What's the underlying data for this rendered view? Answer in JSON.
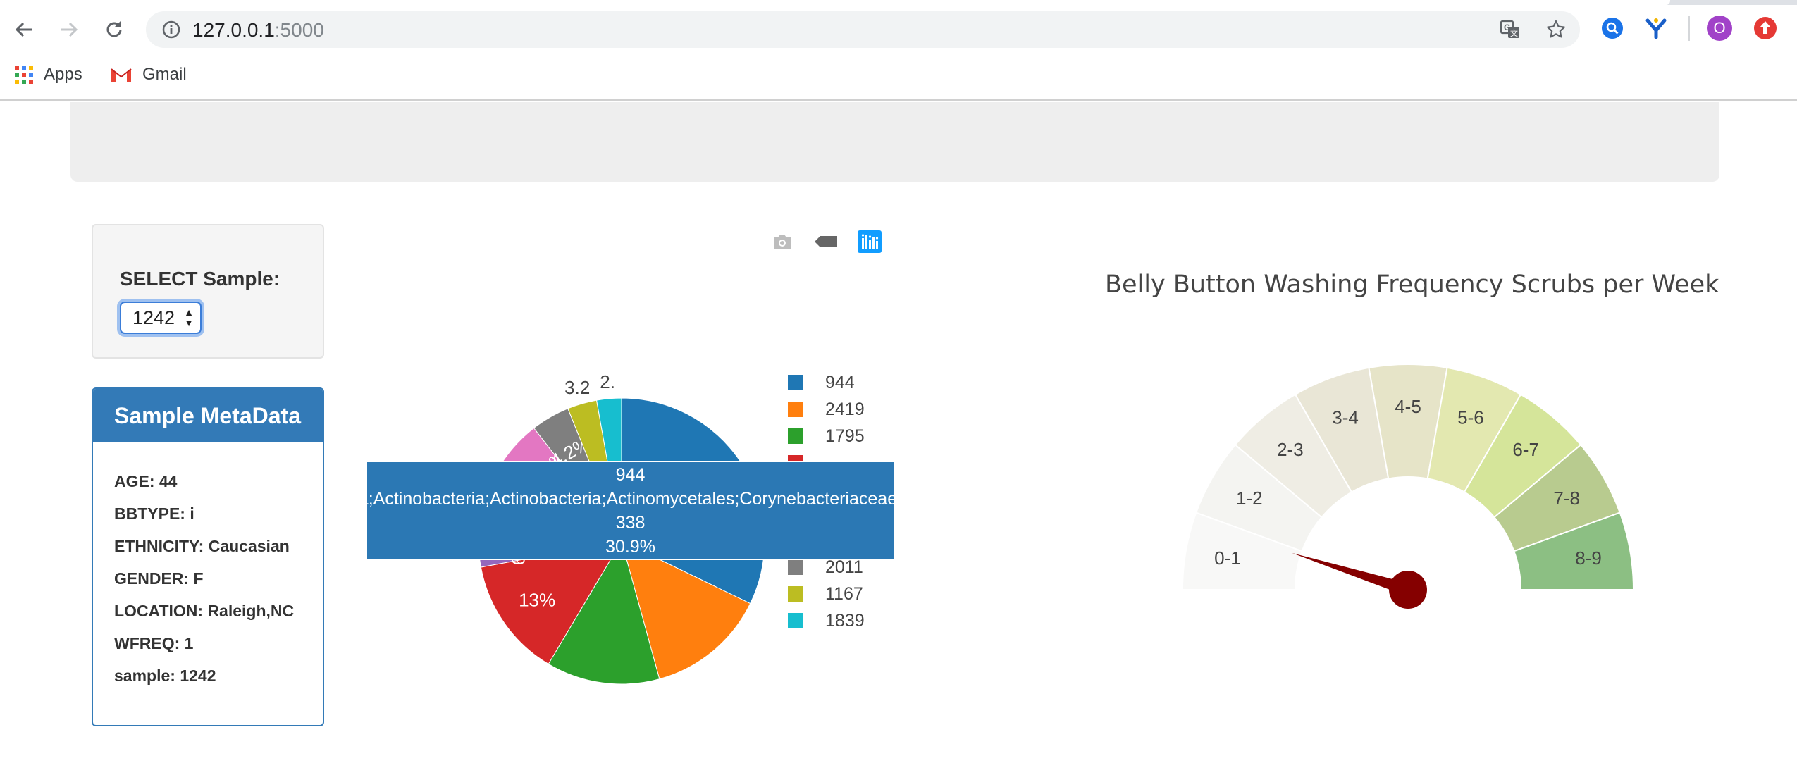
{
  "browser": {
    "url_host": "127.0.0.1",
    "url_port": ":5000",
    "bookmarks": [
      {
        "label": "Apps",
        "icon": "apps-grid-icon"
      },
      {
        "label": "Gmail",
        "icon": "gmail-icon"
      }
    ],
    "profile_initial": "O"
  },
  "selector": {
    "label": "SELECT Sample:",
    "selected": "1242"
  },
  "metadata": {
    "heading": "Sample MetaData",
    "rows": [
      "AGE: 44",
      "BBTYPE: i",
      "ETHNICITY: Caucasian",
      "GENDER: F",
      "LOCATION: Raleigh,NC",
      "WFREQ: 1",
      "sample: 1242"
    ]
  },
  "modebar": {
    "icons": [
      "camera-icon",
      "tag-icon",
      "plotly-logo-icon"
    ]
  },
  "chart_data": [
    {
      "type": "pie",
      "slices": [
        {
          "label": "944",
          "percent": 30.9,
          "color": "#1f77b4"
        },
        {
          "label": "2419",
          "percent": 13.0,
          "color": "#ff7f0e"
        },
        {
          "label": "1795",
          "percent": 12.3,
          "color": "#2ca02c"
        },
        {
          "label": "",
          "percent": 13.0,
          "color": "#d62728",
          "text": "13%"
        },
        {
          "label": "",
          "percent": 6.12,
          "color": "#9467bd",
          "text": "6.12%"
        },
        {
          "label": "",
          "percent": 5.39,
          "color": "#8c564b",
          "text": "5.39%"
        },
        {
          "label": "",
          "percent": 5.21,
          "color": "#e377c2",
          "text": "5.21%"
        },
        {
          "label": "2011",
          "percent": 4.2,
          "color": "#7f7f7f",
          "text": "4.2%"
        },
        {
          "label": "1167",
          "percent": 3.2,
          "color": "#bcbd22",
          "text": "3.2"
        },
        {
          "label": "1839",
          "percent": 2.68,
          "color": "#17becf",
          "text": "2."
        }
      ],
      "legend": [
        {
          "label": "944",
          "color": "#1f77b4"
        },
        {
          "label": "2419",
          "color": "#ff7f0e"
        },
        {
          "label": "1795",
          "color": "#2ca02c"
        },
        {
          "label": "",
          "color": "#d62728"
        },
        {
          "label": "2011",
          "color": "#7f7f7f"
        },
        {
          "label": "1167",
          "color": "#bcbd22"
        },
        {
          "label": "1839",
          "color": "#17becf"
        }
      ],
      "hover": {
        "label": "944",
        "taxonomy": "Bacteria;Actinobacteria;Actinobacteria;Actinomycetales;Corynebacteriaceae;Corynebacterium",
        "value": "338",
        "percent": "30.9%"
      }
    },
    {
      "type": "gauge",
      "title": "Belly Button Washing Frequency Scrubs per Week",
      "sectors": [
        "0-1",
        "1-2",
        "2-3",
        "3-4",
        "4-5",
        "5-6",
        "6-7",
        "7-8",
        "8-9"
      ],
      "colors": [
        "#f8f8f7",
        "#f4f4f1",
        "#efede4",
        "#e9e6d6",
        "#e6e4c8",
        "#e3e8b0",
        "#d5e59a",
        "#b8cb8f",
        "#8cbf83"
      ],
      "value": 1,
      "needle_color": "#850000"
    }
  ]
}
